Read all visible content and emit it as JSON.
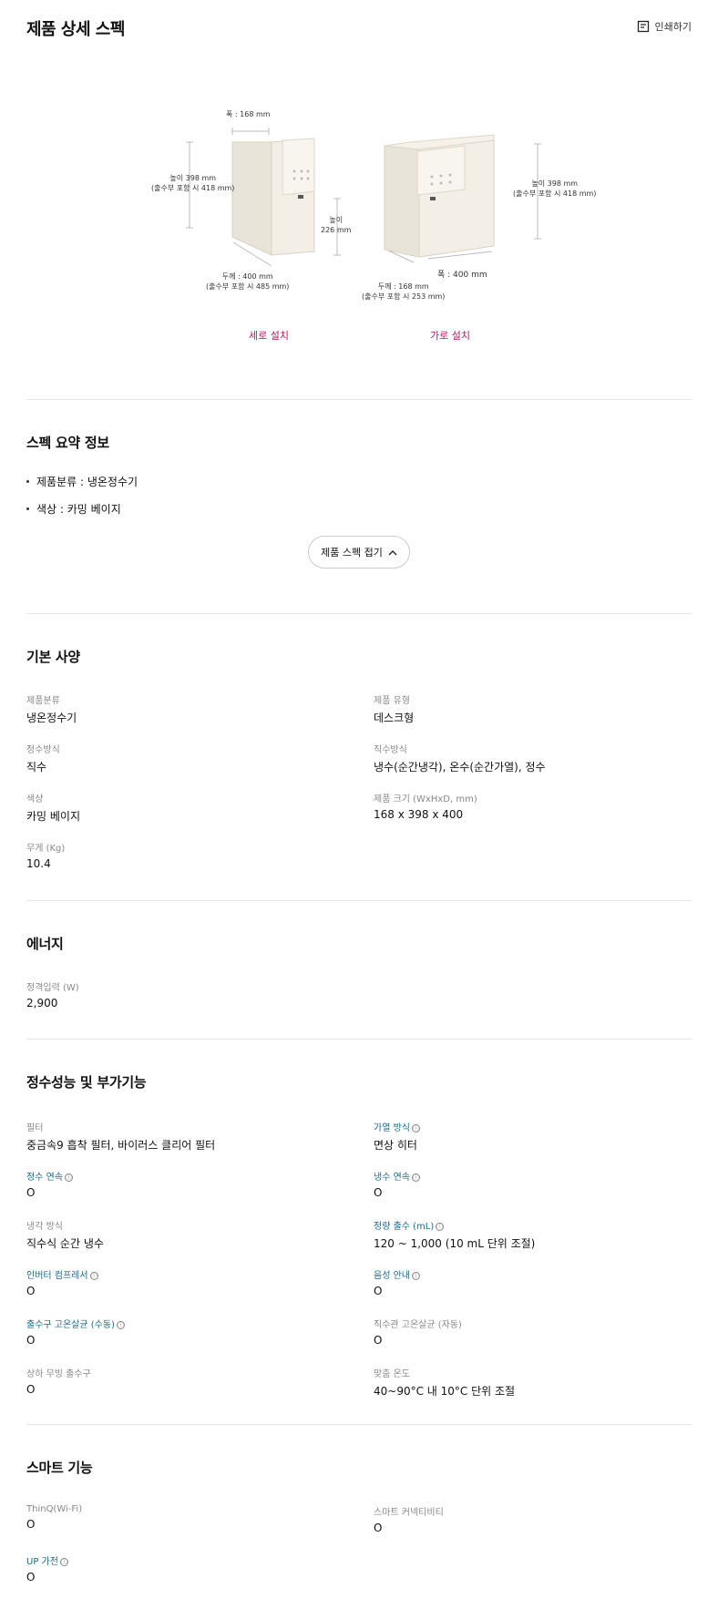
{
  "header": {
    "title": "제품 상세 스펙",
    "print_label": "인쇄하기"
  },
  "diagram": {
    "vertical": {
      "width": "폭 : 168 mm",
      "height_line1": "높이 398 mm",
      "height_line2": "(출수부 포함 시 418 mm)",
      "spout_height_line1": "높이",
      "spout_height_line2": "226 mm",
      "depth_line1": "두께 : 400 mm",
      "depth_line2": "(출수부 포함 시 485 mm)",
      "caption": "세로 설치"
    },
    "horizontal": {
      "height_line1": "높이 398 mm",
      "height_line2": "(출수부 포함 시 418 mm)",
      "width": "폭 : 400 mm",
      "depth_line1": "두께 : 168 mm",
      "depth_line2": "(출수부 포함 시 253 mm)",
      "caption": "가로 설치"
    }
  },
  "summary": {
    "title": "스펙 요약 정보",
    "items": [
      "제품분류 : 냉온정수기",
      "색상 : 카밍 베이지"
    ],
    "collapse_label": "제품 스펙 접기"
  },
  "basic": {
    "title": "기본 사양",
    "specs": [
      {
        "label": "제품분류",
        "value": "냉온정수기"
      },
      {
        "label": "제품 유형",
        "value": "데스크형"
      },
      {
        "label": "정수방식",
        "value": "직수"
      },
      {
        "label": "직수방식",
        "value": "냉수(순간냉각), 온수(순간가열), 정수"
      },
      {
        "label": "색상",
        "value": "카밍 베이지"
      },
      {
        "label": "제품 크기 (WxHxD, mm)",
        "value": "168 x 398 x 400"
      },
      {
        "label": "무게 (Kg)",
        "value": "10.4"
      }
    ]
  },
  "energy": {
    "title": "에너지",
    "specs": [
      {
        "label": "정격입력 (W)",
        "value": "2,900"
      }
    ]
  },
  "performance": {
    "title": "정수성능 및 부가기능",
    "specs": [
      {
        "label": "필터",
        "value": "중금속9 흡착 필터, 바이러스 클리어 필터"
      },
      {
        "label": "가열 방식",
        "value": "면상 히터"
      },
      {
        "label": "정수 연속",
        "value": "O"
      },
      {
        "label": "냉수 연속",
        "value": "O"
      },
      {
        "label": "냉각 방식",
        "value": "직수식 순간 냉수"
      },
      {
        "label": "정량 출수 (mL)",
        "value": "120 ~ 1,000 (10 mL 단위 조절)"
      },
      {
        "label": "인버터 컴프레서",
        "value": "O"
      },
      {
        "label": "음성 안내",
        "value": "O"
      },
      {
        "label": "출수구 고온살균 (수동)",
        "value": "O"
      },
      {
        "label": "직수관 고온살균 (자동)",
        "value": "O"
      },
      {
        "label": "상하 무빙 출수구",
        "value": "O"
      },
      {
        "label": "맞춤 온도",
        "value": "40~90°C 내 10°C 단위 조절"
      }
    ]
  },
  "smart": {
    "title": "스마트 기능",
    "specs": [
      {
        "label": "ThinQ(Wi-Fi)",
        "value": "O"
      },
      {
        "label": "스마트 커넥티비티",
        "value": "O"
      },
      {
        "label": "UP 가전",
        "value": "O"
      }
    ]
  },
  "info_icon": "ⓘ",
  "colors": {
    "accent_link": "#1a6b8a",
    "caption_red": "#c2185b",
    "product_beige": "#eee9df"
  }
}
